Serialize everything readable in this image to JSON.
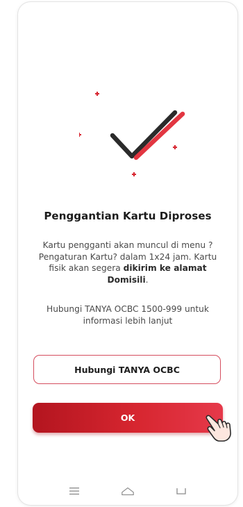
{
  "dialog": {
    "title": "Penggantian Kartu Diproses",
    "description_part1": "Kartu pengganti akan muncul di menu ? Pengaturan Kartu? dalam 1x24 jam. Kartu fisik akan segera ",
    "description_bold": "dikirim ke alamat Domisili",
    "description_end": ".",
    "contact_info": "Hubungi TANYA OCBC 1500-999 untuk informasi lebih lanjut"
  },
  "buttons": {
    "contact_label": "Hubungi TANYA OCBC",
    "ok_label": "OK"
  },
  "colors": {
    "accent_red": "#D72630",
    "check_dark": "#2B2B2B"
  },
  "icons": {
    "success": "checkmark-icon",
    "pointer": "hand-pointer-icon",
    "nav": [
      "menu-icon",
      "home-icon",
      "back-icon"
    ]
  }
}
